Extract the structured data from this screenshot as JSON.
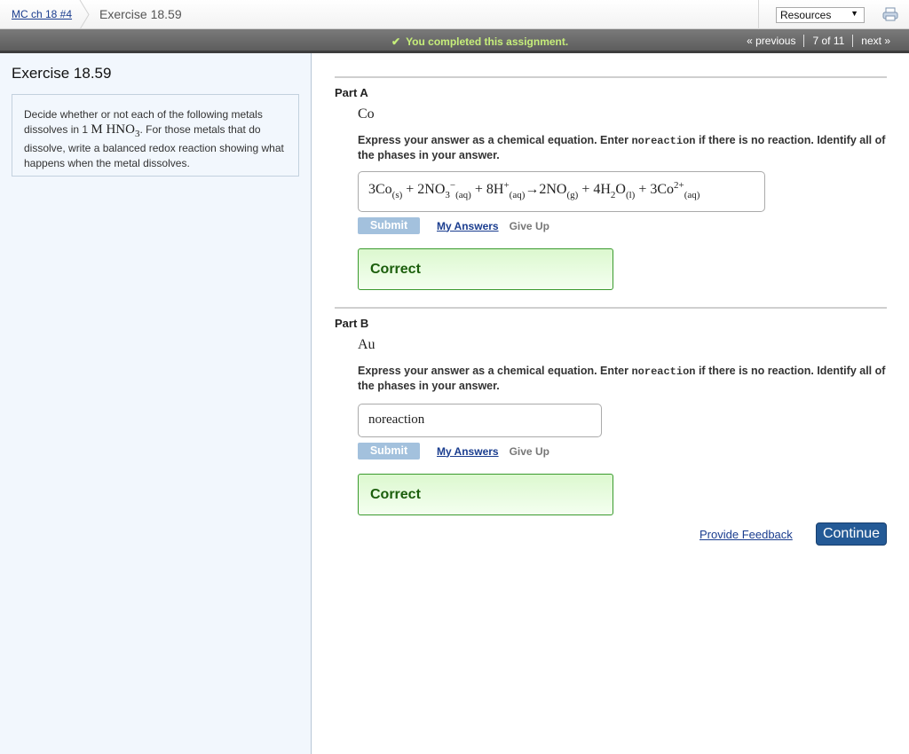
{
  "breadcrumb": {
    "parent_link": "MC ch 18 #4",
    "current": "Exercise 18.59"
  },
  "toolbar": {
    "resources_select": {
      "selected": "Resources",
      "arrow": "▼"
    },
    "print_icon": "printer-icon"
  },
  "status": {
    "check_glyph": "✔",
    "message": "You completed this assignment."
  },
  "pager": {
    "previous": "« previous",
    "position": "7 of 11",
    "next": "next »"
  },
  "sidebar": {
    "title": "Exercise 18.59",
    "problem": {
      "text_before": "Decide whether or not each of the following metals dissolves in 1 ",
      "math": "M HNO",
      "math_sub": "3",
      "text_after": ". For those metals that do dissolve, write a balanced redox reaction showing what happens when the metal dissolves."
    }
  },
  "parts": [
    {
      "label": "Part A",
      "element": "Co",
      "instructions_before": "Express your answer as a chemical equation. Enter ",
      "instructions_code": "noreaction",
      "instructions_after": " if there is no reaction. Identify all of the phases in your answer.",
      "answer": {
        "t1": "3Co",
        "s1": "(s)",
        "t2": " + 2NO",
        "s2": "3",
        "p2": "−",
        "s2b": "(aq)",
        "t3": " + 8H",
        "p3": "+",
        "s3": "(aq)",
        "t4": "→2NO",
        "s4": "(g)",
        "t5": " + 4H",
        "s5a": "2",
        "t5b": "O",
        "s5": "(l)",
        "t6": " + 3Co",
        "p6": "2+",
        "s6": "(aq)"
      },
      "submit_label": "Submit",
      "my_answers_label": "My Answers",
      "give_up_label": "Give Up",
      "result": "Correct"
    },
    {
      "label": "Part B",
      "element": "Au",
      "instructions_before": "Express your answer as a chemical equation. Enter ",
      "instructions_code": "noreaction",
      "instructions_after": " if there is no reaction. Identify all of the phases in your answer.",
      "answer_text": "noreaction",
      "submit_label": "Submit",
      "my_answers_label": "My Answers",
      "give_up_label": "Give Up",
      "result": "Correct"
    }
  ],
  "footer": {
    "feedback_link": "Provide Feedback",
    "continue_label": "Continue"
  },
  "colors": {
    "link": "#1a3d8f",
    "status_text": "#c6ee7a",
    "correct_text": "#1b5e0c",
    "continue_bg": "#245a96",
    "submit_disabled": "#a3c1dd"
  }
}
